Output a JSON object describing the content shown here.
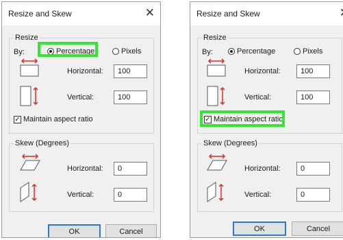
{
  "left": {
    "title": "Resize and Skew",
    "close_glyph": "✕",
    "resize": {
      "legend": "Resize",
      "by_label": "By:",
      "percentage_label": "Percentage",
      "pixels_label": "Pixels",
      "selected": "Percentage",
      "horizontal_label": "Horizontal:",
      "horizontal_value": "100",
      "vertical_label": "Vertical:",
      "vertical_value": "100",
      "maintain_label": "Maintain aspect ratio",
      "maintain_checked": true
    },
    "skew": {
      "legend": "Skew (Degrees)",
      "horizontal_label": "Horizontal:",
      "horizontal_value": "0",
      "vertical_label": "Vertical:",
      "vertical_value": "0"
    },
    "ok_label": "OK",
    "cancel_label": "Cancel"
  },
  "right": {
    "title": "Resize and Skew",
    "close_glyph": "✕",
    "resize": {
      "legend": "Resize",
      "by_label": "By:",
      "percentage_label": "Percentage",
      "pixels_label": "Pixels",
      "selected": "Percentage",
      "horizontal_label": "Horizontal:",
      "horizontal_value": "100",
      "vertical_label": "Vertical:",
      "vertical_value": "100",
      "maintain_label": "Maintain aspect ratio",
      "maintain_checked": true
    },
    "skew": {
      "legend": "Skew (Degrees)",
      "horizontal_label": "Horizontal:",
      "horizontal_value": "0",
      "vertical_label": "Vertical:",
      "vertical_value": "0"
    },
    "ok_label": "OK",
    "cancel_label": "Cancel"
  },
  "colors": {
    "highlight": "#33e633",
    "accent_arrow": "#d92b2b",
    "primary_border": "#2b78d0"
  },
  "icons": [
    "resize-horizontal-icon",
    "resize-vertical-icon",
    "skew-horizontal-icon",
    "skew-vertical-icon"
  ]
}
